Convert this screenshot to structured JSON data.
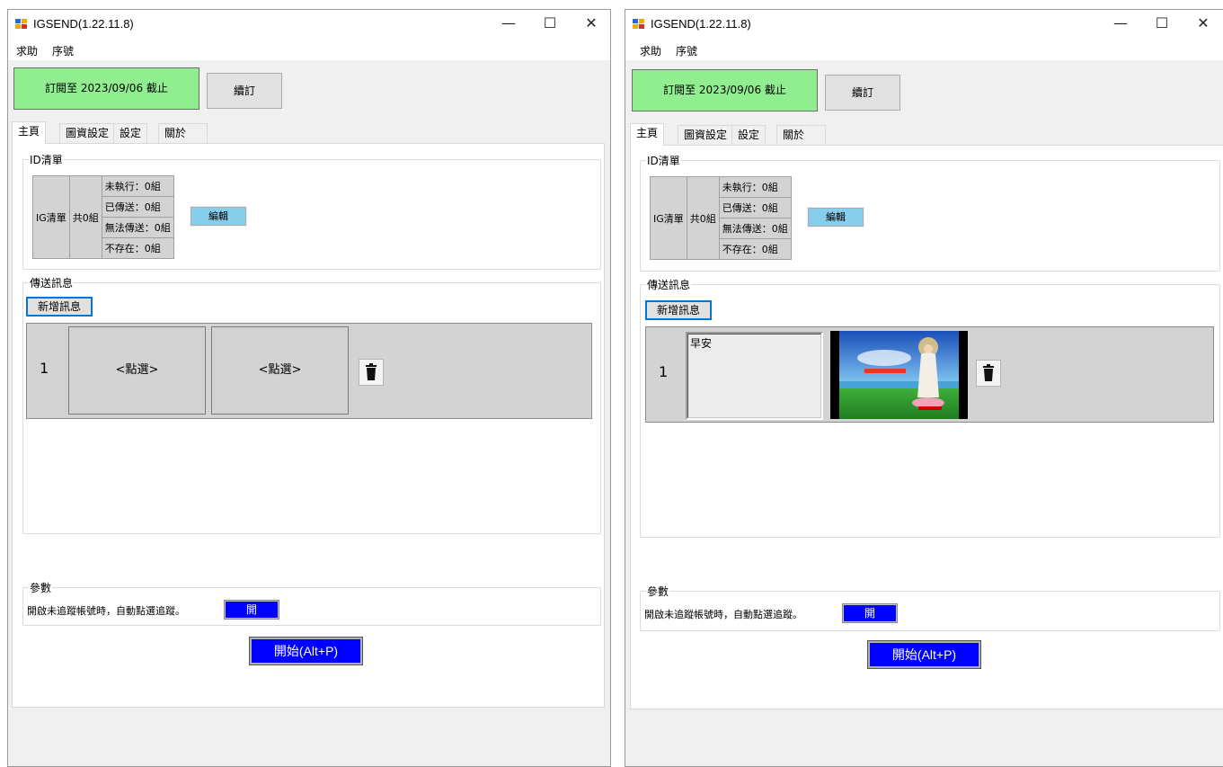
{
  "windows": [
    {
      "title": "IGSEND(1.22.11.8)",
      "controls": {
        "minimize": "—",
        "maximize": "☐",
        "close": "✕"
      },
      "menu": [
        "求助",
        "序號"
      ],
      "subscription": "訂閱至 2023/09/06 截止",
      "renew_label": "續訂",
      "tabs": [
        "主頁",
        "圖資設定",
        "設定",
        "關於"
      ],
      "id_group": {
        "title": "ID清單",
        "list_label": "IG清單",
        "total": "共0組",
        "stats": [
          "未執行：0組",
          "已傳送：0組",
          "無法傳送：0組",
          "不存在：0組"
        ],
        "edit_label": "編輯"
      },
      "msg_group": {
        "title": "傳送訊息",
        "add_label": "新增訊息",
        "rows": [
          {
            "num": "1",
            "text": "<點選>",
            "image": "<點選>"
          }
        ]
      },
      "param_group": {
        "title": "參數",
        "auto_follow_text": "開啟未追蹤帳號時，自動點選追蹤。",
        "toggle_label": "開"
      },
      "start_label": "開始(Alt+P)"
    },
    {
      "title": "IGSEND(1.22.11.8)",
      "controls": {
        "minimize": "—",
        "maximize": "☐",
        "close": "✕"
      },
      "menu": [
        "求助",
        "序號"
      ],
      "subscription": "訂閱至 2023/09/06 截止",
      "renew_label": "續訂",
      "tabs": [
        "主頁",
        "圖資設定",
        "設定",
        "關於"
      ],
      "id_group": {
        "title": "ID清單",
        "list_label": "IG清單",
        "total": "共0組",
        "stats": [
          "未執行：0組",
          "已傳送：0組",
          "無法傳送：0組",
          "不存在：0組"
        ],
        "edit_label": "編輯"
      },
      "msg_group": {
        "title": "傳送訊息",
        "add_label": "新增訊息",
        "rows": [
          {
            "num": "1",
            "text": "早安",
            "image": "guanyin-bodhisattva-picture"
          }
        ]
      },
      "param_group": {
        "title": "參數",
        "auto_follow_text": "開啟未追蹤帳號時，自動點選追蹤。",
        "toggle_label": "開"
      },
      "start_label": "開始(Alt+P)"
    }
  ],
  "colors": {
    "subscription_bg": "#90ee90",
    "edit_bg": "#87ceeb",
    "toggle_bg": "#0000ff",
    "start_bg": "#0000ff",
    "row_bg": "#d3d3d3"
  }
}
